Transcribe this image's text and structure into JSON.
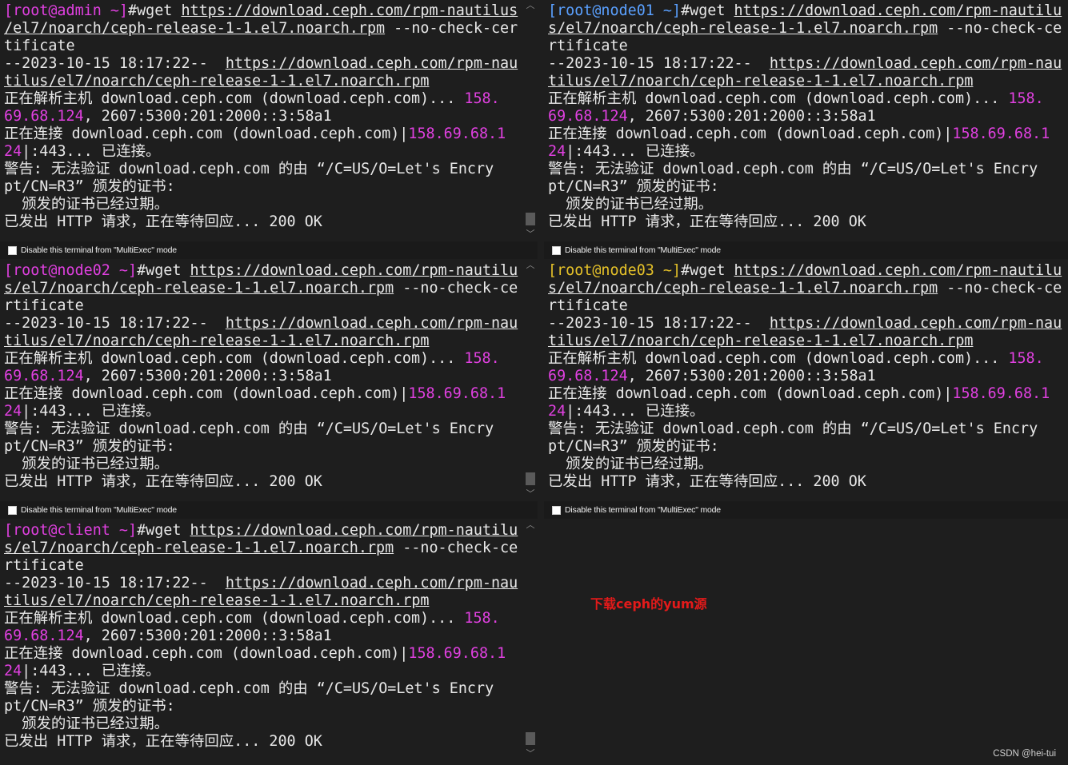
{
  "panes": [
    {
      "host": "admin",
      "prompt_prefix": "[root@admin ~]",
      "prompt_color": "#e040e0",
      "footer_label": "Disable this terminal from \"MultiExec\" mode",
      "lines": [
        [
          {
            "t": "[root@admin ~]",
            "c": "#e040e0"
          },
          {
            "t": "#wget "
          },
          {
            "t": "https://download.ceph.com/rpm-nautilus",
            "u": 1
          }
        ],
        [
          {
            "t": "/el7/noarch/ceph-release-1-1.el7.noarch.rpm",
            "u": 1
          },
          {
            "t": " --no-check-cer"
          }
        ],
        [
          {
            "t": "tificate"
          }
        ],
        [
          {
            "t": "--2023-10-15 18:17:22--  "
          },
          {
            "t": "https://download.ceph.com/rpm-nau",
            "u": 1
          }
        ],
        [
          {
            "t": "tilus/el7/noarch/ceph-release-1-1.el7.noarch.rpm",
            "u": 1
          }
        ],
        [
          {
            "t": "正在解析主机 download.ceph.com (download.ceph.com)... "
          },
          {
            "t": "158.",
            "c": "#e040e0"
          }
        ],
        [
          {
            "t": "69.68.124",
            "c": "#e040e0"
          },
          {
            "t": ", 2607:5300:201:2000::3:58a1"
          }
        ],
        [
          {
            "t": "正在连接 download.ceph.com (download.ceph.com)|"
          },
          {
            "t": "158.69.68.1",
            "c": "#e040e0"
          }
        ],
        [
          {
            "t": "24",
            "c": "#e040e0"
          },
          {
            "t": "|:443... 已连接。"
          }
        ],
        [
          {
            "t": "警告: 无法验证 download.ceph.com 的由 “/C=US/O=Let's Encry"
          }
        ],
        [
          {
            "t": "pt/CN=R3” 颁发的证书:"
          }
        ],
        [
          {
            "t": "  颁发的证书已经过期。"
          }
        ],
        [
          {
            "t": "已发出 HTTP 请求，正在等待回应... 200 OK"
          }
        ]
      ]
    },
    {
      "host": "node01",
      "prompt_prefix": "[root@node01 ~]",
      "prompt_color": "#5aa0ff",
      "footer_label": "Disable this terminal from \"MultiExec\" mode",
      "lines": [
        [
          {
            "t": "[root@node01 ~]",
            "c": "#5aa0ff"
          },
          {
            "t": "#wget "
          },
          {
            "t": "https://download.ceph.com/rpm-nautilu",
            "u": 1
          }
        ],
        [
          {
            "t": "s/el7/noarch/ceph-release-1-1.el7.noarch.rpm",
            "u": 1
          },
          {
            "t": " --no-check-ce"
          }
        ],
        [
          {
            "t": "rtificate"
          }
        ],
        [
          {
            "t": "--2023-10-15 18:17:22--  "
          },
          {
            "t": "https://download.ceph.com/rpm-nau",
            "u": 1
          }
        ],
        [
          {
            "t": "tilus/el7/noarch/ceph-release-1-1.el7.noarch.rpm",
            "u": 1
          }
        ],
        [
          {
            "t": "正在解析主机 download.ceph.com (download.ceph.com)... "
          },
          {
            "t": "158.",
            "c": "#e040e0"
          }
        ],
        [
          {
            "t": "69.68.124",
            "c": "#e040e0"
          },
          {
            "t": ", 2607:5300:201:2000::3:58a1"
          }
        ],
        [
          {
            "t": "正在连接 download.ceph.com (download.ceph.com)|"
          },
          {
            "t": "158.69.68.1",
            "c": "#e040e0"
          }
        ],
        [
          {
            "t": "24",
            "c": "#e040e0"
          },
          {
            "t": "|:443... 已连接。"
          }
        ],
        [
          {
            "t": "警告: 无法验证 download.ceph.com 的由 “/C=US/O=Let's Encry"
          }
        ],
        [
          {
            "t": "pt/CN=R3” 颁发的证书:"
          }
        ],
        [
          {
            "t": "  颁发的证书已经过期。"
          }
        ],
        [
          {
            "t": "已发出 HTTP 请求，正在等待回应... 200 OK"
          }
        ]
      ]
    },
    {
      "host": "node02",
      "prompt_prefix": "[root@node02 ~]",
      "prompt_color": "#e040e0",
      "footer_label": "Disable this terminal from \"MultiExec\" mode",
      "lines": [
        [
          {
            "t": "[root@node02 ~]",
            "c": "#e040e0"
          },
          {
            "t": "#wget "
          },
          {
            "t": "https://download.ceph.com/rpm-nautilu",
            "u": 1
          }
        ],
        [
          {
            "t": "s/el7/noarch/ceph-release-1-1.el7.noarch.rpm",
            "u": 1
          },
          {
            "t": " --no-check-ce"
          }
        ],
        [
          {
            "t": "rtificate"
          }
        ],
        [
          {
            "t": "--2023-10-15 18:17:22--  "
          },
          {
            "t": "https://download.ceph.com/rpm-nau",
            "u": 1
          }
        ],
        [
          {
            "t": "tilus/el7/noarch/ceph-release-1-1.el7.noarch.rpm",
            "u": 1
          }
        ],
        [
          {
            "t": "正在解析主机 download.ceph.com (download.ceph.com)... "
          },
          {
            "t": "158.",
            "c": "#e040e0"
          }
        ],
        [
          {
            "t": "69.68.124",
            "c": "#e040e0"
          },
          {
            "t": ", 2607:5300:201:2000::3:58a1"
          }
        ],
        [
          {
            "t": "正在连接 download.ceph.com (download.ceph.com)|"
          },
          {
            "t": "158.69.68.1",
            "c": "#e040e0"
          }
        ],
        [
          {
            "t": "24",
            "c": "#e040e0"
          },
          {
            "t": "|:443... 已连接。"
          }
        ],
        [
          {
            "t": "警告: 无法验证 download.ceph.com 的由 “/C=US/O=Let's Encry"
          }
        ],
        [
          {
            "t": "pt/CN=R3” 颁发的证书:"
          }
        ],
        [
          {
            "t": "  颁发的证书已经过期。"
          }
        ],
        [
          {
            "t": "已发出 HTTP 请求，正在等待回应... 200 OK"
          }
        ]
      ]
    },
    {
      "host": "node03",
      "prompt_prefix": "[root@node03 ~]",
      "prompt_color": "#e6c229",
      "footer_label": "Disable this terminal from \"MultiExec\" mode",
      "lines": [
        [
          {
            "t": "[root@node03 ~]",
            "c": "#e6c229"
          },
          {
            "t": "#wget "
          },
          {
            "t": "https://download.ceph.com/rpm-nautilu",
            "u": 1
          }
        ],
        [
          {
            "t": "s/el7/noarch/ceph-release-1-1.el7.noarch.rpm",
            "u": 1
          },
          {
            "t": " --no-check-ce"
          }
        ],
        [
          {
            "t": "rtificate"
          }
        ],
        [
          {
            "t": "--2023-10-15 18:17:22--  "
          },
          {
            "t": "https://download.ceph.com/rpm-nau",
            "u": 1
          }
        ],
        [
          {
            "t": "tilus/el7/noarch/ceph-release-1-1.el7.noarch.rpm",
            "u": 1
          }
        ],
        [
          {
            "t": "正在解析主机 download.ceph.com (download.ceph.com)... "
          },
          {
            "t": "158.",
            "c": "#e040e0"
          }
        ],
        [
          {
            "t": "69.68.124",
            "c": "#e040e0"
          },
          {
            "t": ", 2607:5300:201:2000::3:58a1"
          }
        ],
        [
          {
            "t": "正在连接 download.ceph.com (download.ceph.com)|"
          },
          {
            "t": "158.69.68.1",
            "c": "#e040e0"
          }
        ],
        [
          {
            "t": "24",
            "c": "#e040e0"
          },
          {
            "t": "|:443... 已连接。"
          }
        ],
        [
          {
            "t": "警告: 无法验证 download.ceph.com 的由 “/C=US/O=Let's Encry"
          }
        ],
        [
          {
            "t": "pt/CN=R3” 颁发的证书:"
          }
        ],
        [
          {
            "t": "  颁发的证书已经过期。"
          }
        ],
        [
          {
            "t": "已发出 HTTP 请求，正在等待回应... 200 OK"
          }
        ]
      ]
    },
    {
      "host": "client",
      "prompt_prefix": "[root@client ~]",
      "prompt_color": "#e040e0",
      "footer_label": "",
      "lines": [
        [
          {
            "t": "[root@client ~]",
            "c": "#e040e0"
          },
          {
            "t": "#wget "
          },
          {
            "t": "https://download.ceph.com/rpm-nautilu",
            "u": 1
          }
        ],
        [
          {
            "t": "s/el7/noarch/ceph-release-1-1.el7.noarch.rpm",
            "u": 1
          },
          {
            "t": " --no-check-ce"
          }
        ],
        [
          {
            "t": "rtificate"
          }
        ],
        [
          {
            "t": "--2023-10-15 18:17:22--  "
          },
          {
            "t": "https://download.ceph.com/rpm-nau",
            "u": 1
          }
        ],
        [
          {
            "t": "tilus/el7/noarch/ceph-release-1-1.el7.noarch.rpm",
            "u": 1
          }
        ],
        [
          {
            "t": "正在解析主机 download.ceph.com (download.ceph.com)... "
          },
          {
            "t": "158.",
            "c": "#e040e0"
          }
        ],
        [
          {
            "t": "69.68.124",
            "c": "#e040e0"
          },
          {
            "t": ", 2607:5300:201:2000::3:58a1"
          }
        ],
        [
          {
            "t": "正在连接 download.ceph.com (download.ceph.com)|"
          },
          {
            "t": "158.69.68.1",
            "c": "#e040e0"
          }
        ],
        [
          {
            "t": "24",
            "c": "#e040e0"
          },
          {
            "t": "|:443... 已连接。"
          }
        ],
        [
          {
            "t": "警告: 无法验证 download.ceph.com 的由 “/C=US/O=Let's Encry"
          }
        ],
        [
          {
            "t": "pt/CN=R3” 颁发的证书:"
          }
        ],
        [
          {
            "t": "  颁发的证书已经过期。"
          }
        ],
        [
          {
            "t": "已发出 HTTP 请求，正在等待回应... 200 OK"
          }
        ]
      ]
    }
  ],
  "annotation": "下载ceph的yum源",
  "watermark": "CSDN @hei-tui",
  "colors": {
    "background": "#1e1e1e",
    "text": "#e8e8e8",
    "ip_magenta": "#e040e0",
    "annotation_red": "#e41a1a"
  },
  "icons": {
    "scroll_up": "chevron-up-icon",
    "scroll_down": "chevron-down-icon",
    "checkbox": "checkbox-unchecked-icon"
  }
}
